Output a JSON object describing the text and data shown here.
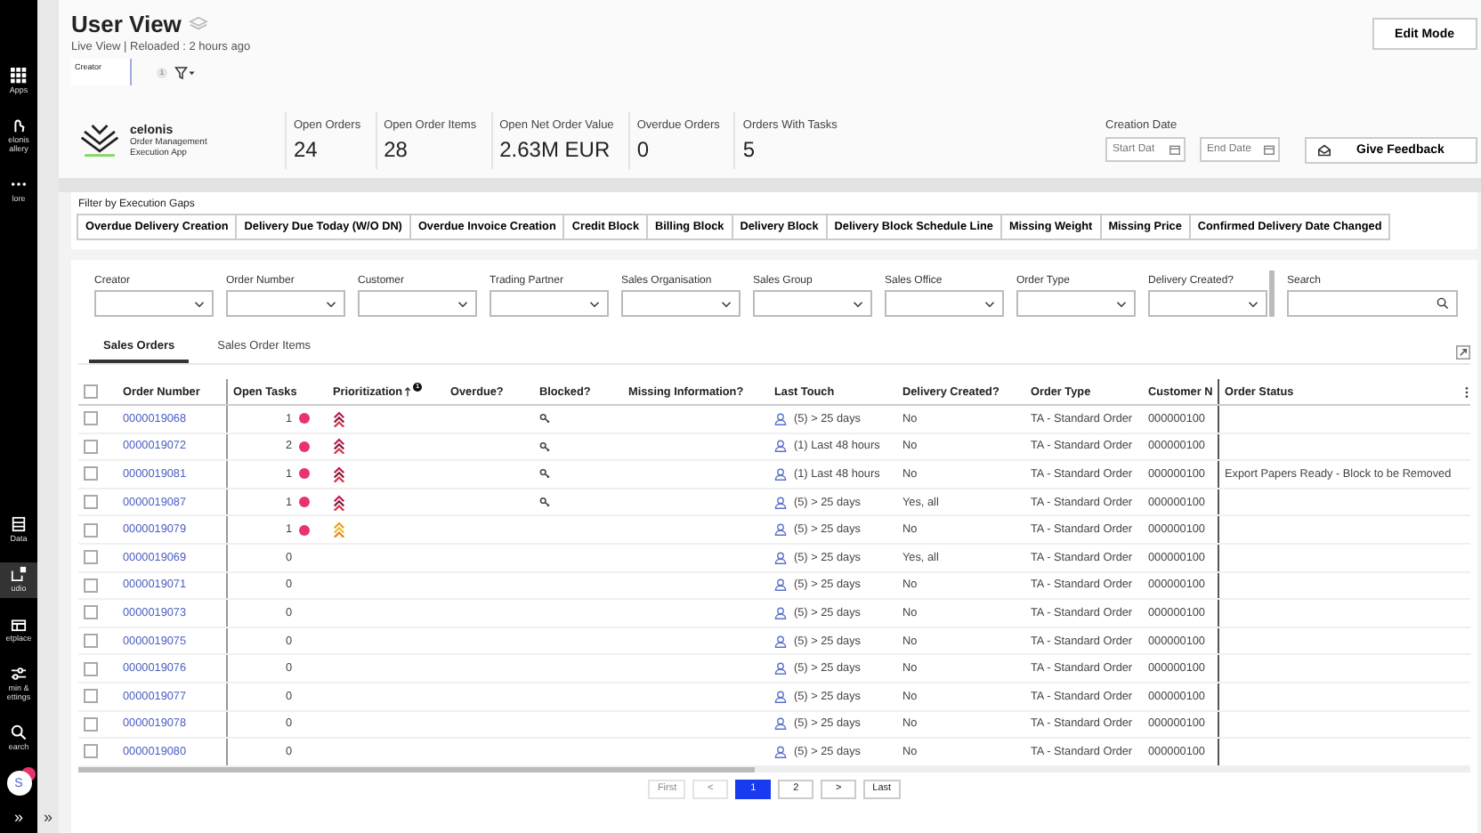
{
  "sidebar": {
    "items": [
      {
        "label": "Apps",
        "kind": "grid",
        "selected": false
      },
      {
        "label": "elonis allery",
        "kind": "hand",
        "selected": false
      },
      {
        "label": "lore",
        "kind": "dots",
        "selected": false
      },
      {
        "label": "Data",
        "kind": "data",
        "selected": false
      },
      {
        "label": "udio",
        "kind": "studio",
        "selected": true
      },
      {
        "label": "etplace",
        "kind": "store",
        "selected": false
      },
      {
        "label": "min & ettings",
        "kind": "sliders",
        "selected": false
      },
      {
        "label": "earch",
        "kind": "search",
        "selected": false
      }
    ],
    "avatar": "S",
    "collapse": "»",
    "expand": "»"
  },
  "header": {
    "title": "User View",
    "subtitle": "Live View | Reloaded : 2 hours ago",
    "filter_label": "Creator",
    "filter_count": "1",
    "edit_button": "Edit Mode"
  },
  "kpis": {
    "logo_name": "celonis",
    "logo_sub": "Order Management Execution App",
    "items": [
      {
        "label": "Open Orders",
        "value": "24"
      },
      {
        "label": "Open Order Items",
        "value": "28"
      },
      {
        "label": "Open Net Order Value",
        "value": "2.63M EUR"
      },
      {
        "label": "Overdue Orders",
        "value": "0"
      },
      {
        "label": "Orders With Tasks",
        "value": "5"
      }
    ],
    "date_label": "Creation Date",
    "start_placeholder": "Start Dat",
    "end_placeholder": "End Date",
    "feedback": "Give Feedback"
  },
  "gaps": {
    "title": "Filter by Execution Gaps",
    "buttons": [
      "Overdue Delivery Creation",
      "Delivery Due Today (W/O DN)",
      "Overdue Invoice Creation",
      "Credit Block",
      "Billing Block",
      "Delivery Block",
      "Delivery Block Schedule Line",
      "Missing Weight",
      "Missing Price",
      "Confirmed Delivery Date Changed"
    ]
  },
  "filters": [
    {
      "label": "Creator"
    },
    {
      "label": "Order Number"
    },
    {
      "label": "Customer"
    },
    {
      "label": "Trading Partner"
    },
    {
      "label": "Sales Organisation"
    },
    {
      "label": "Sales Group"
    },
    {
      "label": "Sales Office"
    },
    {
      "label": "Order Type"
    },
    {
      "label": "Delivery Created?"
    }
  ],
  "search": {
    "label": "Search"
  },
  "tabs": [
    {
      "label": "Sales Orders",
      "selected": true
    },
    {
      "label": "Sales Order Items",
      "selected": false
    }
  ],
  "table": {
    "columns": [
      "Order Number",
      "Open Tasks",
      "Prioritization",
      "Overdue?",
      "Blocked?",
      "Missing Information?",
      "Last Touch",
      "Delivery Created?",
      "Order Type",
      "Customer N",
      "Order Status"
    ],
    "sort_badge": "1",
    "all_checked": false,
    "rows": [
      {
        "checked": false,
        "order": "0000019068",
        "open_tasks": "1",
        "task_dot": true,
        "kind": "high",
        "blocked": true,
        "last_touch": "(5) > 25 days",
        "delivery": "No",
        "order_type": "TA - Standard Order",
        "customer": "000000100",
        "status": ""
      },
      {
        "checked": false,
        "order": "0000019072",
        "open_tasks": "2",
        "task_dot": true,
        "kind": "high",
        "blocked": true,
        "last_touch": "(1) Last 48 hours",
        "delivery": "No",
        "order_type": "TA - Standard Order",
        "customer": "000000100",
        "status": ""
      },
      {
        "checked": false,
        "order": "0000019081",
        "open_tasks": "1",
        "task_dot": true,
        "kind": "high",
        "blocked": true,
        "last_touch": "(1) Last 48 hours",
        "delivery": "No",
        "order_type": "TA - Standard Order",
        "customer": "000000100",
        "status": "Export Papers Ready - Block to be Removed"
      },
      {
        "checked": false,
        "order": "0000019087",
        "open_tasks": "1",
        "task_dot": true,
        "kind": "high",
        "blocked": true,
        "last_touch": "(5) > 25 days",
        "delivery": "Yes, all",
        "order_type": "TA - Standard Order",
        "customer": "000000100",
        "status": ""
      },
      {
        "checked": false,
        "order": "0000019079",
        "open_tasks": "1",
        "task_dot": true,
        "kind": "medium",
        "blocked": false,
        "last_touch": "(5) > 25 days",
        "delivery": "No",
        "order_type": "TA - Standard Order",
        "customer": "000000100",
        "status": ""
      },
      {
        "checked": false,
        "order": "0000019069",
        "open_tasks": "0",
        "task_dot": false,
        "kind": "none",
        "blocked": false,
        "last_touch": "(5) > 25 days",
        "delivery": "Yes, all",
        "order_type": "TA - Standard Order",
        "customer": "000000100",
        "status": ""
      },
      {
        "checked": false,
        "order": "0000019071",
        "open_tasks": "0",
        "task_dot": false,
        "kind": "none",
        "blocked": false,
        "last_touch": "(5) > 25 days",
        "delivery": "No",
        "order_type": "TA - Standard Order",
        "customer": "000000100",
        "status": ""
      },
      {
        "checked": false,
        "order": "0000019073",
        "open_tasks": "0",
        "task_dot": false,
        "kind": "none",
        "blocked": false,
        "last_touch": "(5) > 25 days",
        "delivery": "No",
        "order_type": "TA - Standard Order",
        "customer": "000000100",
        "status": ""
      },
      {
        "checked": false,
        "order": "0000019075",
        "open_tasks": "0",
        "task_dot": false,
        "kind": "none",
        "blocked": false,
        "last_touch": "(5) > 25 days",
        "delivery": "No",
        "order_type": "TA - Standard Order",
        "customer": "000000100",
        "status": ""
      },
      {
        "checked": false,
        "order": "0000019076",
        "open_tasks": "0",
        "task_dot": false,
        "kind": "none",
        "blocked": false,
        "last_touch": "(5) > 25 days",
        "delivery": "No",
        "order_type": "TA - Standard Order",
        "customer": "000000100",
        "status": ""
      },
      {
        "checked": false,
        "order": "0000019077",
        "open_tasks": "0",
        "task_dot": false,
        "kind": "none",
        "blocked": false,
        "last_touch": "(5) > 25 days",
        "delivery": "No",
        "order_type": "TA - Standard Order",
        "customer": "000000100",
        "status": ""
      },
      {
        "checked": false,
        "order": "0000019078",
        "open_tasks": "0",
        "task_dot": false,
        "kind": "none",
        "blocked": false,
        "last_touch": "(5) > 25 days",
        "delivery": "No",
        "order_type": "TA - Standard Order",
        "customer": "000000100",
        "status": ""
      },
      {
        "checked": false,
        "order": "0000019080",
        "open_tasks": "0",
        "task_dot": false,
        "kind": "none",
        "blocked": false,
        "last_touch": "(5) > 25 days",
        "delivery": "No",
        "order_type": "TA - Standard Order",
        "customer": "000000100",
        "status": ""
      }
    ]
  },
  "pagination": [
    {
      "label": "First",
      "disabled": true,
      "selected": false
    },
    {
      "label": "<",
      "disabled": true,
      "selected": false
    },
    {
      "label": "1",
      "disabled": false,
      "selected": true
    },
    {
      "label": "2",
      "disabled": false,
      "selected": false
    },
    {
      "label": ">",
      "disabled": false,
      "selected": false
    },
    {
      "label": "Last",
      "disabled": false,
      "selected": false
    }
  ]
}
